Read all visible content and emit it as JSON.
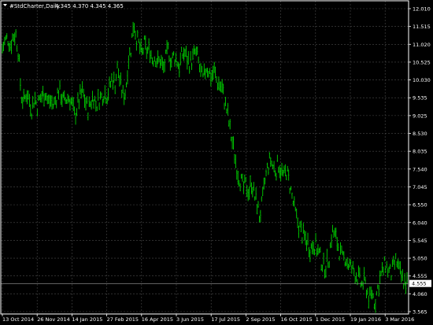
{
  "header": {
    "symbol_text": "#StdCharter,Daily",
    "ohlc_text": "4.345 4.370 4.345 4.365"
  },
  "colors": {
    "background": "#000000",
    "bar": "#00d000",
    "grid": "#4a4a4a",
    "text": "#ffffff",
    "current_line": "#9a9a9a"
  },
  "current_price_label": "4.555",
  "chart_data": {
    "type": "line",
    "series": [
      {
        "values": [
          10.9,
          11.1,
          11.2,
          11.0,
          11.25,
          11.3,
          10.8,
          9.6,
          9.4,
          9.7,
          9.5,
          9.2,
          9.55,
          9.3,
          9.5,
          9.6,
          9.7,
          9.4,
          9.45,
          9.3,
          9.5,
          9.75,
          9.6,
          9.4,
          9.5,
          9.55,
          9.35,
          9.0,
          9.3,
          9.55,
          9.7,
          9.4,
          9.2,
          9.4,
          9.6,
          9.3,
          9.5,
          9.55,
          9.7,
          9.6,
          9.8,
          10.1,
          9.9,
          10.4,
          9.9,
          9.6,
          9.7,
          10.6,
          10.9,
          11.7,
          11.2,
          11.0,
          10.7,
          11.0,
          10.8,
          10.9,
          10.6,
          10.7,
          10.5,
          10.6,
          10.3,
          10.6,
          10.9,
          10.5,
          10.7,
          10.6,
          10.4,
          10.7,
          10.8,
          10.6,
          10.5,
          10.6,
          10.8,
          10.6,
          10.2,
          10.0,
          10.4,
          10.3,
          10.1,
          10.3,
          10.0,
          9.9,
          9.8,
          9.4,
          9.1,
          8.6,
          8.2,
          7.8,
          7.4,
          7.2,
          7.0,
          7.1,
          6.9,
          7.2,
          6.8,
          6.6,
          6.2,
          6.6,
          7.2,
          7.6,
          7.8,
          7.6,
          7.5,
          7.7,
          7.5,
          7.3,
          7.5,
          7.2,
          6.8,
          6.4,
          6.1,
          5.9,
          5.7,
          5.6,
          5.5,
          5.3,
          5.5,
          5.4,
          5.2,
          5.0,
          4.8,
          4.9,
          5.1,
          5.8,
          5.7,
          5.5,
          5.2,
          5.0,
          5.1,
          4.9,
          4.8,
          4.7,
          4.6,
          4.5,
          4.3,
          4.4,
          4.2,
          3.9,
          4.1,
          3.8,
          4.2,
          4.5,
          4.7,
          4.9,
          4.7,
          4.6,
          4.8,
          5.0,
          4.7,
          4.5,
          4.4,
          4.35
        ]
      }
    ],
    "yticks": [
      "12.010",
      "11.515",
      "11.020",
      "10.525",
      "10.030",
      "9.535",
      "9.025",
      "8.530",
      "8.035",
      "7.540",
      "7.045",
      "6.550",
      "6.040",
      "5.545",
      "5.050",
      "4.555",
      "4.060",
      "3.565"
    ],
    "xticks": [
      "13 Oct 2014",
      "26 Nov 2014",
      "14 Jan 2015",
      "27 Feb 2015",
      "16 Apr 2015",
      "3 Jun 2015",
      "17 Jul 2015",
      "2 Sep 2015",
      "16 Oct 2015",
      "1 Dec 2015",
      "19 Jan 2016",
      "3 Mar 2016"
    ],
    "ylim": [
      3.565,
      12.01
    ],
    "current_price": 4.365,
    "grid": true
  }
}
